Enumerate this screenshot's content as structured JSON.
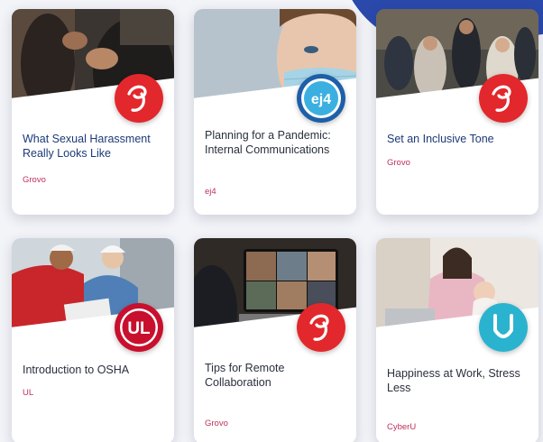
{
  "courses": [
    {
      "title": "What Sexual Harassment Really Looks Like",
      "provider": "Grovo",
      "logo": "grovo-logo",
      "brand_color": "#e2282c"
    },
    {
      "title": "Planning for a Pandemic: Internal Communications",
      "provider": "ej4",
      "logo": "ej4-logo",
      "brand_color": "#1d5fa8"
    },
    {
      "title": "Set an Inclusive Tone",
      "provider": "Grovo",
      "logo": "grovo-logo",
      "brand_color": "#e2282c"
    },
    {
      "title": "Introduction to OSHA",
      "provider": "UL",
      "logo": "ul-logo",
      "brand_color": "#c8102e"
    },
    {
      "title": "Tips for Remote Collaboration",
      "provider": "Grovo",
      "logo": "grovo-logo",
      "brand_color": "#e2282c"
    },
    {
      "title": "Happiness at Work, Stress Less",
      "provider": "CyberU",
      "logo": "cyberu-logo",
      "brand_color": "#2ab3cf"
    }
  ],
  "colors": {
    "title": "#1c3a78",
    "provider": "#c0315b",
    "accent_blue": "#1f3fa6"
  }
}
